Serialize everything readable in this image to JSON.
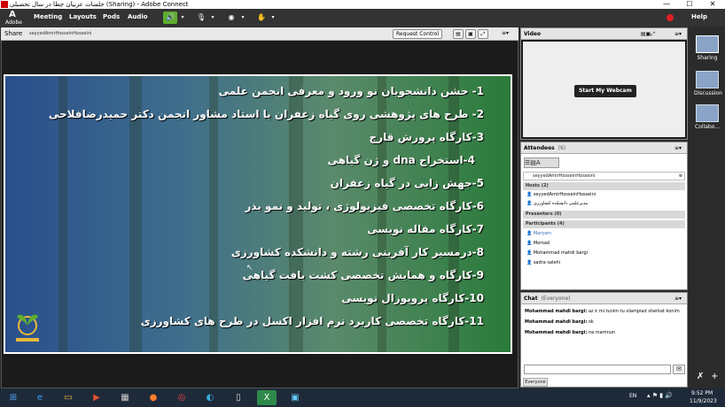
{
  "window": {
    "title": "جلسات عربیان جطا در سال تحصیلی (Sharing) - Adobe Connect",
    "minimize": "—",
    "maximize": "☐",
    "close": "✕"
  },
  "menubar": {
    "logo": "Adobe",
    "items": [
      "Meeting",
      "Layouts",
      "Pods",
      "Audio"
    ],
    "help": "Help"
  },
  "share_pod": {
    "title": "Share",
    "presenter": "seyyedAmirHosseinHosseini",
    "request_control": "Request Control"
  },
  "slide": {
    "lines": [
      "1- جشن دانشجویان نو ورود و معرفی انجمن علمی",
      "2- طرح های پژوهشی روی گیاه زعفران با استاد مشاور انجمن دکتر حمیدرضافلاحی",
      "3-کارگاه پرورش قارچ",
      "4-استخراج dna و ژن گیاهی",
      "5-جهش زایی در گیاه زعفران",
      "6-کارگاه تخصصی فیزیولوژی ، تولید و نمو بذر",
      "7-کارگاه مقاله نویسی",
      "8-درمسیر کار آفرینی رشته و دانشکده کشاورزی",
      "9-کارگاه و همایش تخصصی کشت بافت گیاهی",
      "10-کارگاه پروپوزال نویسی",
      "11-کارگاه تخصصی کاربرد نرم افزار اکسل در طرح های کشاورزی"
    ]
  },
  "video_pod": {
    "title": "Video",
    "start_button": "Start My Webcam"
  },
  "attendees_pod": {
    "title": "Attendees",
    "count": "(6)",
    "current_user": "seyyedAmirHosseinHosseini",
    "hosts_label": "Hosts (2)",
    "hosts": [
      "seyyedAmirHosseinHosseini",
      "مدیرعلمی دانشکده کشاورزی"
    ],
    "presenters_label": "Presenters (0)",
    "participants_label": "Participants (4)",
    "participants": [
      "Maryam",
      "Morsad",
      "Mohammad mahdi bargi",
      "sadra salehi"
    ]
  },
  "chat_pod": {
    "title": "Chat",
    "scope": "(Everyone)",
    "messages": [
      {
        "sender": "Mohammad mahdi bargi:",
        "text": "az k mi tunim tu olampiad sherkat konim"
      },
      {
        "sender": "Mohammad mahdi bargi:",
        "text": "ok"
      },
      {
        "sender": "Mohammad mahdi bargi:",
        "text": "na mamnun"
      }
    ],
    "tab": "Everyone"
  },
  "layouts": [
    {
      "label": "Sharing"
    },
    {
      "label": "Discussion"
    },
    {
      "label": "Collabo..."
    }
  ],
  "taskbar": {
    "lang": "EN",
    "time": "9:52 PM",
    "date": "11/9/2023"
  }
}
